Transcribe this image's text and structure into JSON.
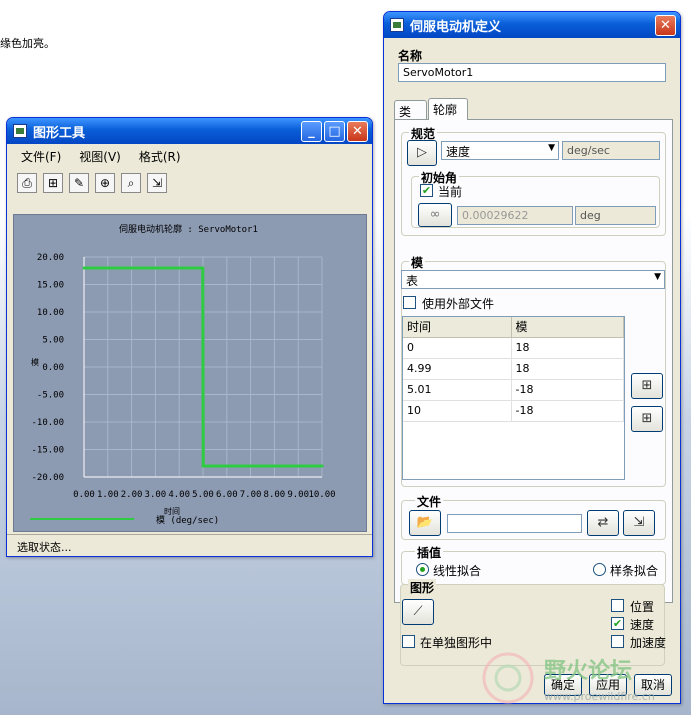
{
  "background": {
    "text": "缘色加亮。"
  },
  "graph_window": {
    "title": "图形工具",
    "menu": [
      "文件(F)",
      "视图(V)",
      "格式(R)"
    ],
    "toolbar_icons": [
      "print-icon",
      "grid-icon",
      "edit-icon",
      "zoom-in-icon",
      "zoom-fit-icon",
      "export-icon"
    ],
    "status": "选取状态..."
  },
  "chart_data": {
    "type": "line",
    "title": "伺服电动机轮廓 : ServoMotor1",
    "xlabel": "模 (deg/sec)",
    "x_unit_label": "时间",
    "ylabel": "模",
    "x_ticks": [
      "0.00",
      "1.00",
      "2.00",
      "3.00",
      "4.00",
      "5.00",
      "6.00",
      "7.00",
      "8.00",
      "9.00",
      "10.00"
    ],
    "y_ticks": [
      "20.00",
      "15.00",
      "10.00",
      "5.00",
      "0.00",
      "-5.00",
      "-10.00",
      "-15.00",
      "-20.00"
    ],
    "xlim": [
      0,
      10
    ],
    "ylim": [
      -20,
      20
    ],
    "grid": true,
    "series": [
      {
        "x": [
          0,
          4.99,
          5.01,
          10
        ],
        "y": [
          18,
          18,
          -18,
          -18
        ],
        "color": "#2ecc40"
      }
    ]
  },
  "servo_dialog": {
    "title": "伺服电动机定义",
    "name_label": "名称",
    "name_value": "ServoMotor1",
    "tabs": [
      "类型",
      "轮廓"
    ],
    "spec_label": "规范",
    "spec_value": "速度",
    "spec_unit": "deg/sec",
    "init_angle_label": "初始角",
    "current_label": "当前",
    "current_checked": true,
    "init_value": "0.00029622",
    "init_unit": "deg",
    "module_label": "模",
    "module_value": "表",
    "use_external_label": "使用外部文件",
    "table_headers": [
      "时间",
      "模"
    ],
    "table_rows": [
      [
        "0",
        "18"
      ],
      [
        "4.99",
        "18"
      ],
      [
        "5.01",
        "-18"
      ],
      [
        "10",
        "-18"
      ]
    ],
    "file_label": "文件",
    "interp_label": "插值",
    "linear_label": "线性拟合",
    "spline_label": "样条拟合",
    "graph_label": "图形",
    "position_label": "位置",
    "velocity_label": "速度",
    "accel_label": "加速度",
    "separate_graph_label": "在单独图形中",
    "ok": "确定",
    "apply": "应用",
    "cancel": "取消"
  },
  "watermark": {
    "text": "野火论坛",
    "url_text": "www.proewildfire.cn"
  }
}
